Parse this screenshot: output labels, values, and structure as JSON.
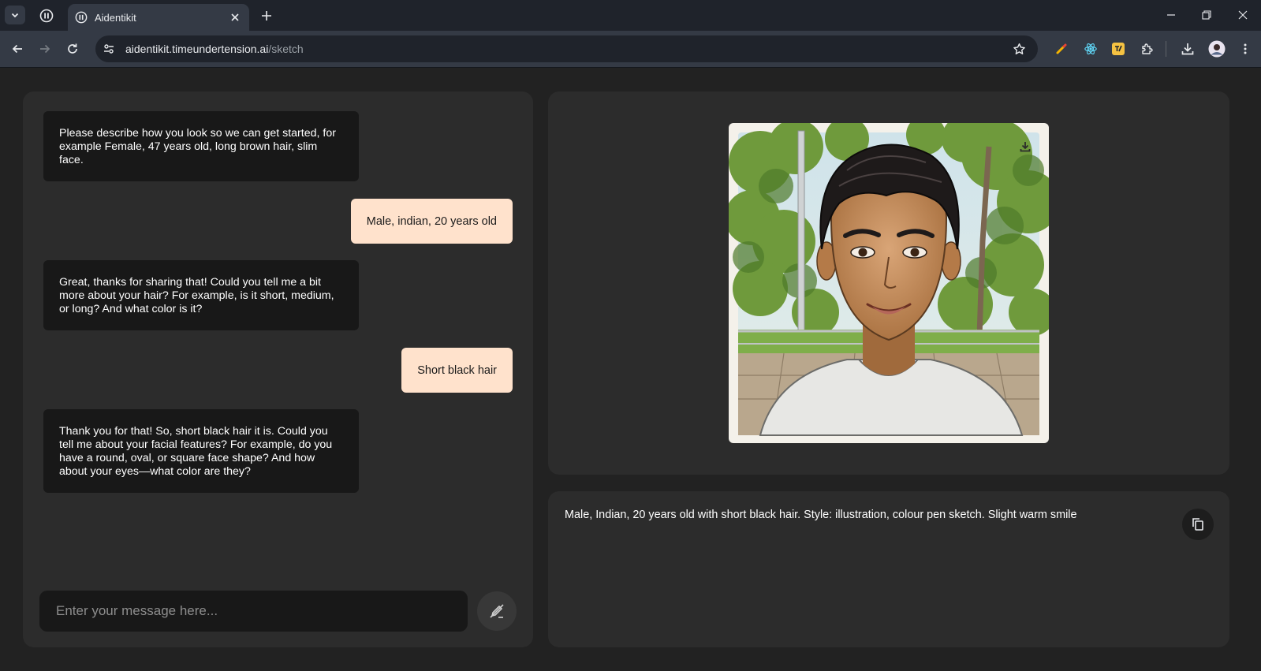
{
  "browser": {
    "tab_title": "Aidentikit",
    "url_host": "aidentikit.timeundertension.ai",
    "url_path": "/sketch"
  },
  "chat": {
    "messages": [
      {
        "role": "assistant",
        "text": "Please describe how you look so we can get started, for example Female, 47 years old, long brown hair, slim face."
      },
      {
        "role": "user",
        "text": "Male, indian, 20 years old"
      },
      {
        "role": "assistant",
        "text": "Great, thanks for sharing that! Could you tell me a bit more about your hair? For example, is it short, medium, or long? And what color is it?"
      },
      {
        "role": "user",
        "text": "Short black hair"
      },
      {
        "role": "assistant",
        "text": "Thank you for that! So, short black hair it is. Could you tell me about your facial features? For example, do you have a round, oval, or square face shape? And how about your eyes—what color are they?"
      }
    ],
    "input_placeholder": "Enter your message here...",
    "input_value": ""
  },
  "sketch": {
    "prompt": "Male, Indian, 20 years old with short black hair. Style: illustration, colour pen sketch. Slight warm smile"
  },
  "icons": {
    "tab_menu": "chevron-down-icon",
    "favicon": "pause-circle-icon",
    "send": "pen-slash-icon",
    "download": "download-icon",
    "copy": "copy-icon"
  },
  "colors": {
    "page_background": "#222222",
    "panel_background": "#2c2c2c",
    "assistant_bubble": "#181818",
    "user_bubble": "#ffe2cc"
  }
}
